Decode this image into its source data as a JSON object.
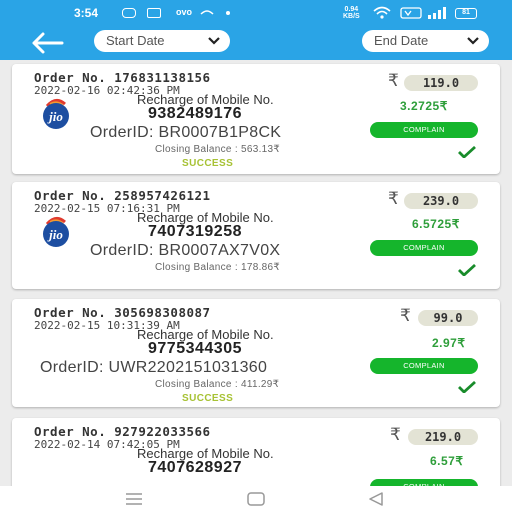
{
  "status_bar": {
    "time": "3:54",
    "carrier": "ovo",
    "speed_value": "0.94",
    "speed_unit": "KB/S",
    "battery": "81"
  },
  "header": {
    "start_date_label": "Start Date",
    "end_date_label": "End Date"
  },
  "orders": [
    {
      "order_no": "Order No. 176831138156",
      "date": "2022-02-16 02:42:36 PM",
      "recharge_label": "Recharge of Mobile No.",
      "mobile": "9382489176",
      "order_id": "OrderID: BR0007B1P8CK",
      "closing_balance": "Closing Balance : 563.13₹",
      "status": "SUCCESS",
      "rupee": "₹",
      "amount": "119.0",
      "commission": "3.2725₹",
      "complain_label": "COMPLAIN",
      "operator_logo": "jio-logo",
      "logo_text": "jio"
    },
    {
      "order_no": "Order No. 258957426121",
      "date": "2022-02-15 07:16:31 PM",
      "recharge_label": "Recharge of Mobile No.",
      "mobile": "7407319258",
      "order_id": "OrderID: BR0007AX7V0X",
      "closing_balance": "Closing Balance : 178.86₹",
      "status": "SUCCESS",
      "rupee": "₹",
      "amount": "239.0",
      "commission": "6.5725₹",
      "complain_label": "COMPLAIN",
      "operator_logo": "jio-logo",
      "logo_text": "jio"
    },
    {
      "order_no": "Order No. 305698308087",
      "date": "2022-02-15 10:31:39 AM",
      "recharge_label": "Recharge of Mobile No.",
      "mobile": "9775344305",
      "order_id": "OrderID: UWR2202151031360",
      "closing_balance": "Closing Balance : 411.29₹",
      "status": "SUCCESS",
      "rupee": "₹",
      "amount": "99.0",
      "commission": "2.97₹",
      "complain_label": "COMPLAIN"
    },
    {
      "order_no": "Order No. 927922033566",
      "date": "2022-02-14 07:42:05 PM",
      "recharge_label": "Recharge of Mobile No.",
      "mobile": "7407628927",
      "rupee": "₹",
      "amount": "219.0",
      "commission": "6.57₹",
      "complain_label": "COMPLAIN"
    }
  ],
  "colors": {
    "primary": "#2aa4e6",
    "success_green": "#15b52c",
    "status_text": "#a7c234",
    "commission": "#2e9e3a"
  },
  "icons": {
    "back": "arrow-left-icon",
    "date_dropdown": "chevron-down-icon",
    "status_check": "checkmark-icon",
    "nav_recents": "recents-icon",
    "nav_home": "home-icon",
    "nav_back": "back-triangle-icon"
  }
}
